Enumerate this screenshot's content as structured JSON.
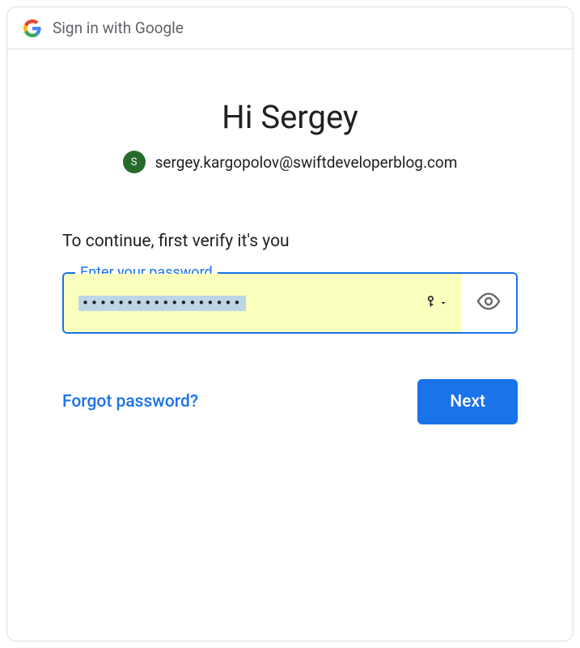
{
  "header": {
    "title": "Sign in with Google"
  },
  "greeting": "Hi Sergey",
  "account": {
    "initial": "S",
    "email": "sergey.kargopolov@swiftdeveloperblog.com"
  },
  "instruction": "To continue, first verify it's you",
  "password_field": {
    "label": "Enter your password",
    "masked_value": "••••••••••••••••••"
  },
  "actions": {
    "forgot": "Forgot password?",
    "next": "Next"
  }
}
